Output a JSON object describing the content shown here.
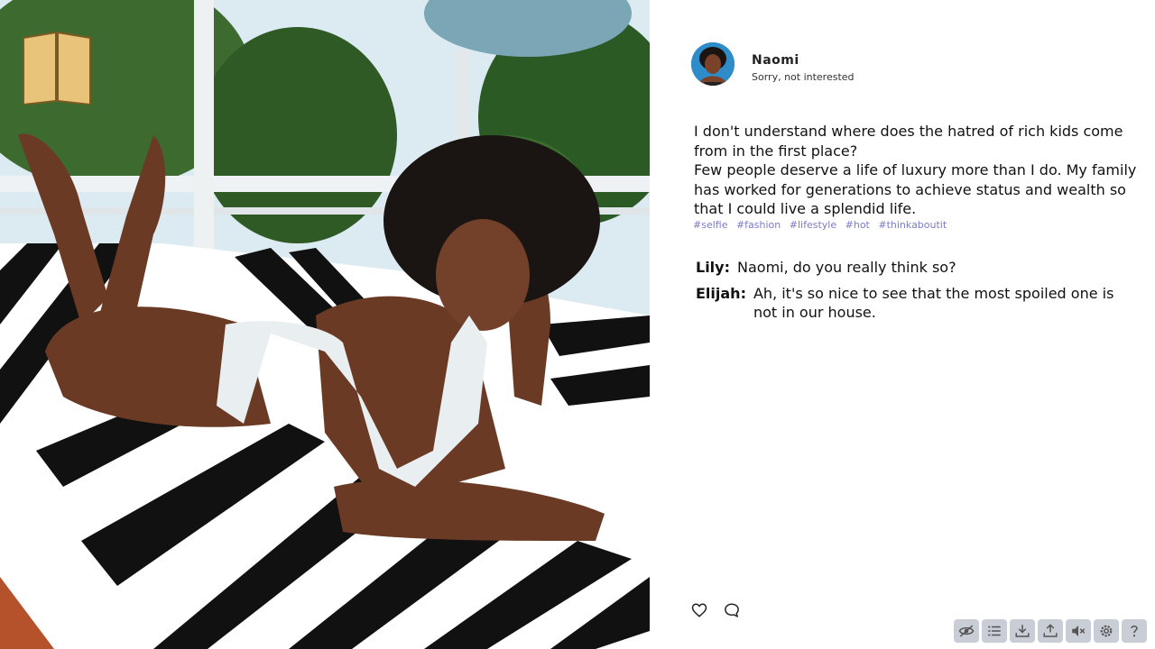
{
  "post": {
    "username": "Naomi",
    "status": "Sorry, not interested",
    "paragraphs": [
      "I don't understand where does the hatred of rich kids come from in the first place?",
      "Few people deserve a life of luxury more than I do. My family has worked for generations to achieve status and wealth so that I could live a splendid life."
    ],
    "tags": [
      "#selfie",
      "#fashion",
      "#lifestyle",
      "#hot",
      "#thinkaboutit"
    ]
  },
  "comments": [
    {
      "author": "Lily:",
      "text": "Naomi, do you really think so?"
    },
    {
      "author": "Elijah:",
      "text": "Ah, it's so nice to see that the most spoiled one is not in our house."
    }
  ],
  "actions": {
    "like_icon": "heart-icon",
    "comment_icon": "speech-bubble-icon"
  },
  "toolbar": {
    "buttons": [
      "hide-ui-icon",
      "history-icon",
      "save-icon",
      "load-icon",
      "mute-icon",
      "settings-icon",
      "help-icon"
    ]
  },
  "colors": {
    "tag": "#7b7bc8",
    "toolbar_button": "#c9cdd6",
    "avatar_bg": "#2e8cc9"
  }
}
